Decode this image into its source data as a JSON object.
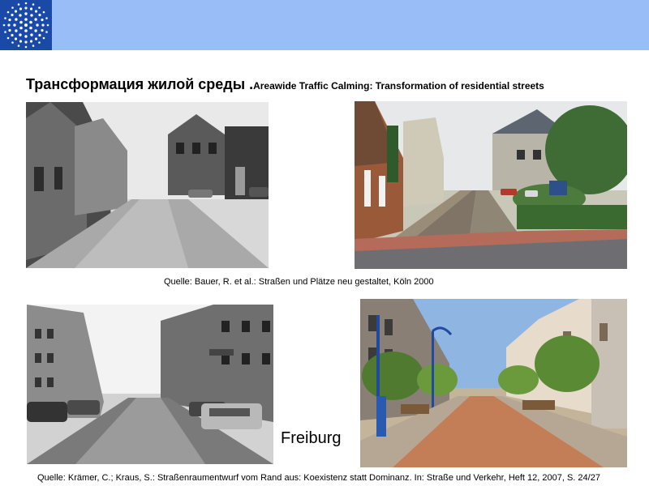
{
  "slide": {
    "title_ru": "Трансформация жилой среды .",
    "title_en": "Areawide Traffic Calming: Transformation of residential streets",
    "caption_top": "Quelle: Bauer, R. et al.: Straßen und Plätze neu gestaltet, Köln 2000",
    "city_label": "Freiburg",
    "caption_bottom": "Quelle: Krämer, C.; Kraus, S.: Straßenraumentwurf vom Rand aus: Koexistenz statt Dominanz. In: Straße und Verkehr, Heft 12, 2007, S. 24/27"
  },
  "colors": {
    "banner": "#99bdf6",
    "logo_bg": "#1a49a8"
  }
}
